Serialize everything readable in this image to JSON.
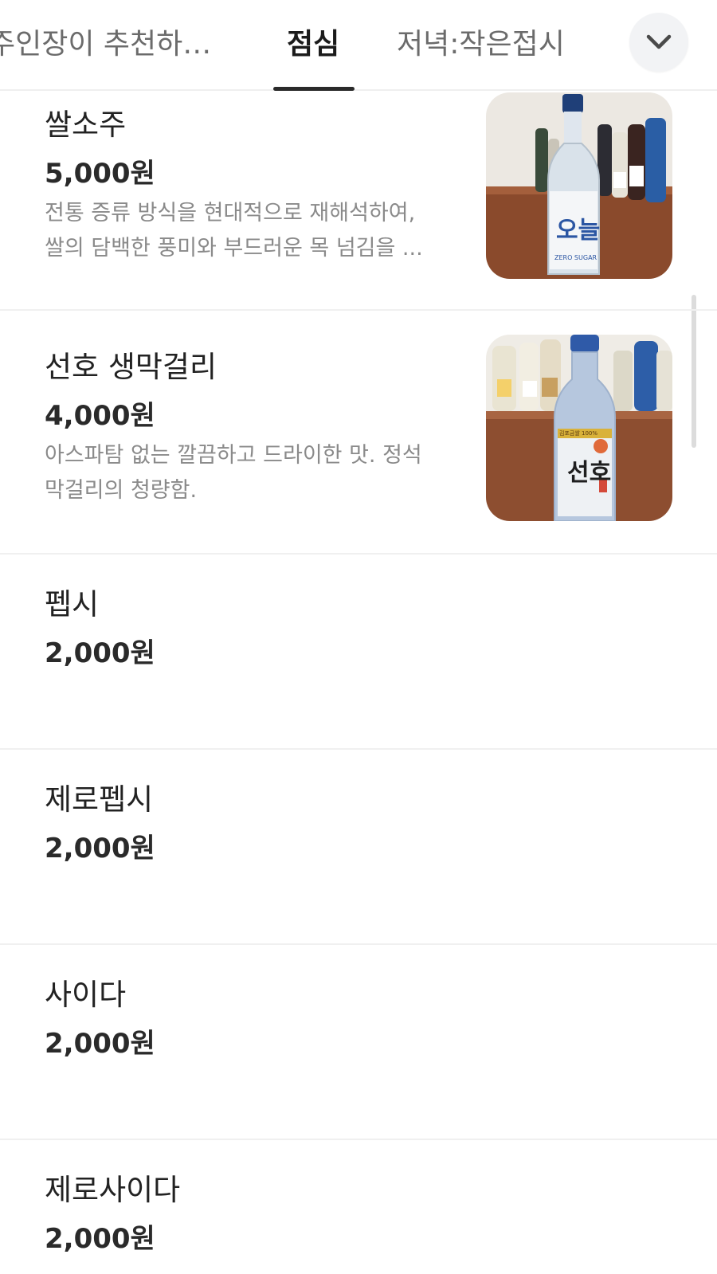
{
  "tabs": [
    {
      "label": "주인장이 추천하는 ..."
    },
    {
      "label": "점심"
    },
    {
      "label": "저녁:작은접시"
    }
  ],
  "more_button": {
    "icon": "chevron-down-icon"
  },
  "menu": [
    {
      "name": "쌀소주",
      "price": "5,000원",
      "desc_lines": [
        "전통 증류 방식을 현대적으로 재해석하여,",
        "쌀의 담백한 풍미와 부드러운 목 넘김을 ..."
      ],
      "image_label": "오늘",
      "image_caption": "ZERO SUGAR"
    },
    {
      "name": "선호 생막걸리",
      "price": "4,000원",
      "desc_lines": [
        "아스파탐 없는 깔끔하고 드라이한 맛. 정석",
        "막걸리의 청량함."
      ],
      "image_label": "선호",
      "image_caption": "김포금쌀 100%"
    },
    {
      "name": "펩시",
      "price": "2,000원",
      "desc_lines": []
    },
    {
      "name": "제로펩시",
      "price": "2,000원",
      "desc_lines": []
    },
    {
      "name": "사이다",
      "price": "2,000원",
      "desc_lines": []
    },
    {
      "name": "제로사이다",
      "price": "2,000원",
      "desc_lines": []
    }
  ],
  "colors": {
    "accent": "#2a2a2a",
    "muted_text": "#8a8a8a",
    "divider": "#f0f0f0"
  }
}
